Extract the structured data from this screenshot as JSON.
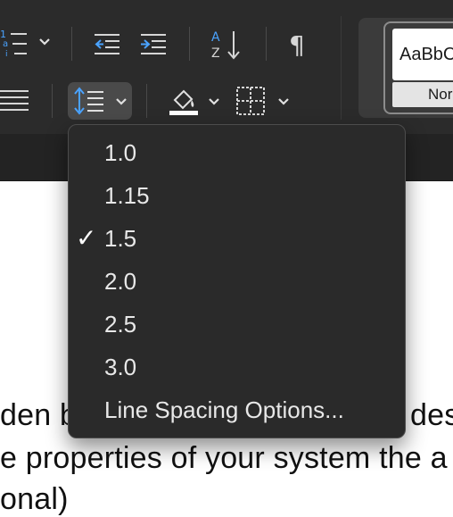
{
  "ribbon": {
    "style_preview_text": "AaBbCcDd",
    "style_name": "Normal"
  },
  "document": {
    "line1": "...hidden beneath... designate",
    "line1_left": "den b",
    "line1_right": "desi",
    "line2": "e properties of your system the a",
    "line3": "onal)"
  },
  "line_spacing_menu": {
    "items": [
      {
        "label": "1.0",
        "checked": false
      },
      {
        "label": "1.15",
        "checked": false
      },
      {
        "label": "1.5",
        "checked": true
      },
      {
        "label": "2.0",
        "checked": false
      },
      {
        "label": "2.5",
        "checked": false
      },
      {
        "label": "3.0",
        "checked": false
      },
      {
        "label": "Line Spacing Options...",
        "checked": false
      }
    ],
    "check_glyph": "✓"
  },
  "colors": {
    "ribbon_bg": "#2b2b2b",
    "menu_bg": "#2a2a2a",
    "accent": "#4aa3ff"
  },
  "icons": [
    "multilevel-list-icon",
    "chevron-down-icon",
    "decrease-indent-icon",
    "increase-indent-icon",
    "sort-icon",
    "show-formatting-marks-icon",
    "justify-align-icon",
    "line-spacing-icon",
    "shading-icon",
    "borders-icon"
  ]
}
